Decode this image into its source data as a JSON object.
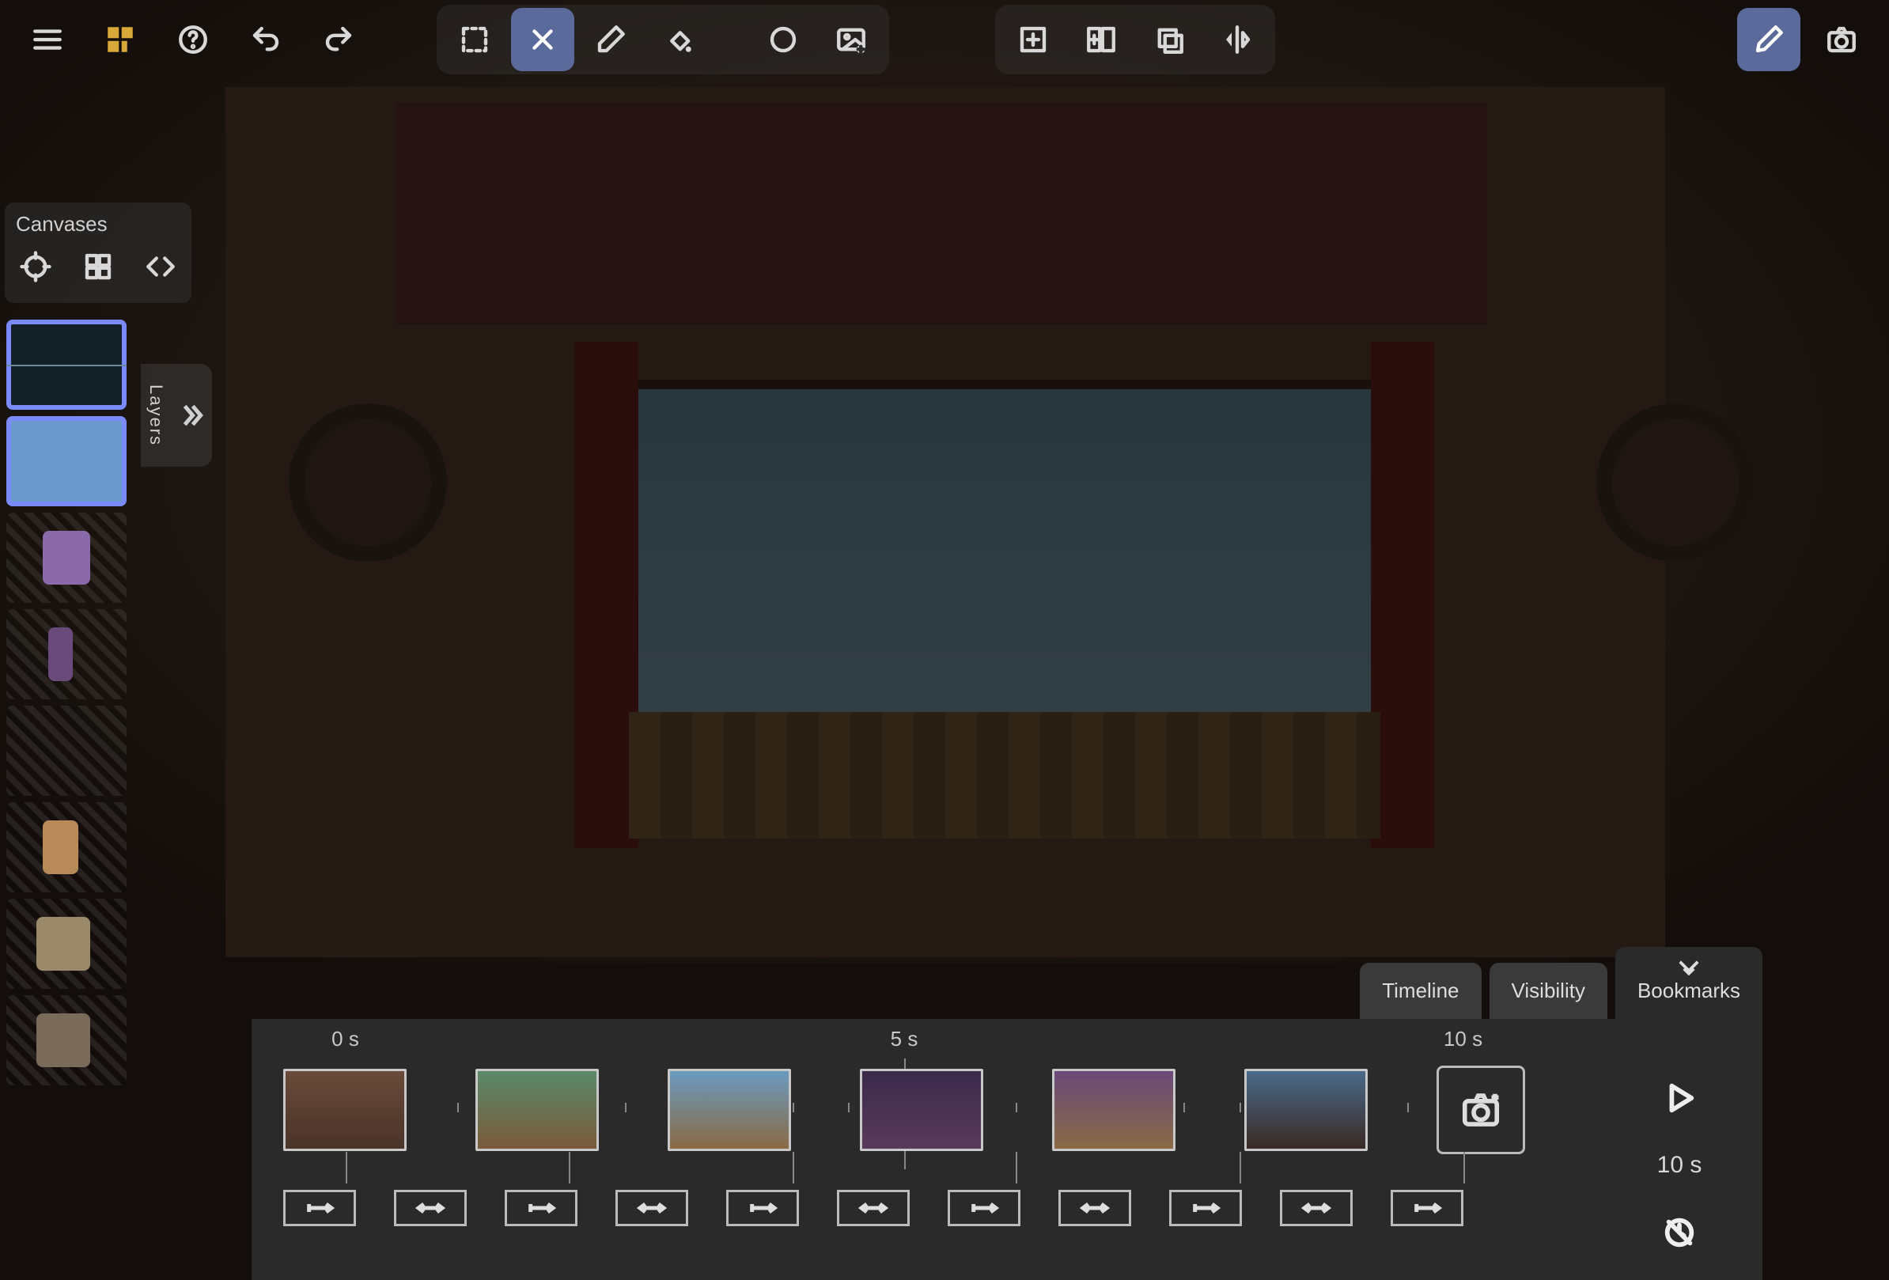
{
  "sidebar": {
    "title": "Canvases",
    "layers_label": "Layers",
    "thumbs": [
      {
        "kind": "wave",
        "selected": true
      },
      {
        "kind": "bluefill",
        "selected": true
      },
      {
        "kind": "hatch"
      },
      {
        "kind": "critter",
        "color": "#8a6aa8"
      },
      {
        "kind": "hatch"
      },
      {
        "kind": "critter",
        "color": "#b88a5a"
      },
      {
        "kind": "hatch"
      },
      {
        "kind": "critter",
        "color": "#9a7a5a"
      }
    ]
  },
  "timeline": {
    "tabs": [
      {
        "id": "timeline",
        "label": "Timeline",
        "active": true
      },
      {
        "id": "visibility",
        "label": "Visibility",
        "active": false
      },
      {
        "id": "bookmarks",
        "label": "Bookmarks",
        "active": false,
        "wide": true
      }
    ],
    "ruler_marks": [
      {
        "pos": 0.05,
        "label": "0 s"
      },
      {
        "pos": 0.5,
        "label": "5 s"
      },
      {
        "pos": 0.95,
        "label": "10 s"
      }
    ],
    "duration_label": "10 s",
    "keyframes": [
      {
        "cls": "kf0"
      },
      {
        "cls": "kf1"
      },
      {
        "cls": "kf2"
      },
      {
        "cls": "kf3"
      },
      {
        "cls": "kf4"
      },
      {
        "cls": "kf5"
      }
    ],
    "tween_count": 11
  },
  "icons": {
    "menu": "menu",
    "logo": "logo",
    "help": "help",
    "undo": "undo",
    "redo": "redo",
    "select": "select",
    "brush": "brush",
    "eraser": "eraser",
    "fill": "fill",
    "shape": "shape",
    "image": "image",
    "addpanel": "addpanel",
    "split": "split",
    "flip": "flip",
    "mirror": "mirror",
    "pen": "pen",
    "camera": "camera",
    "target": "target",
    "grid": "grid",
    "code": "code",
    "chevrons": "chevrons",
    "bookmarks": "bookmarks",
    "addkey": "addkey",
    "play": "play",
    "loop": "loop"
  }
}
